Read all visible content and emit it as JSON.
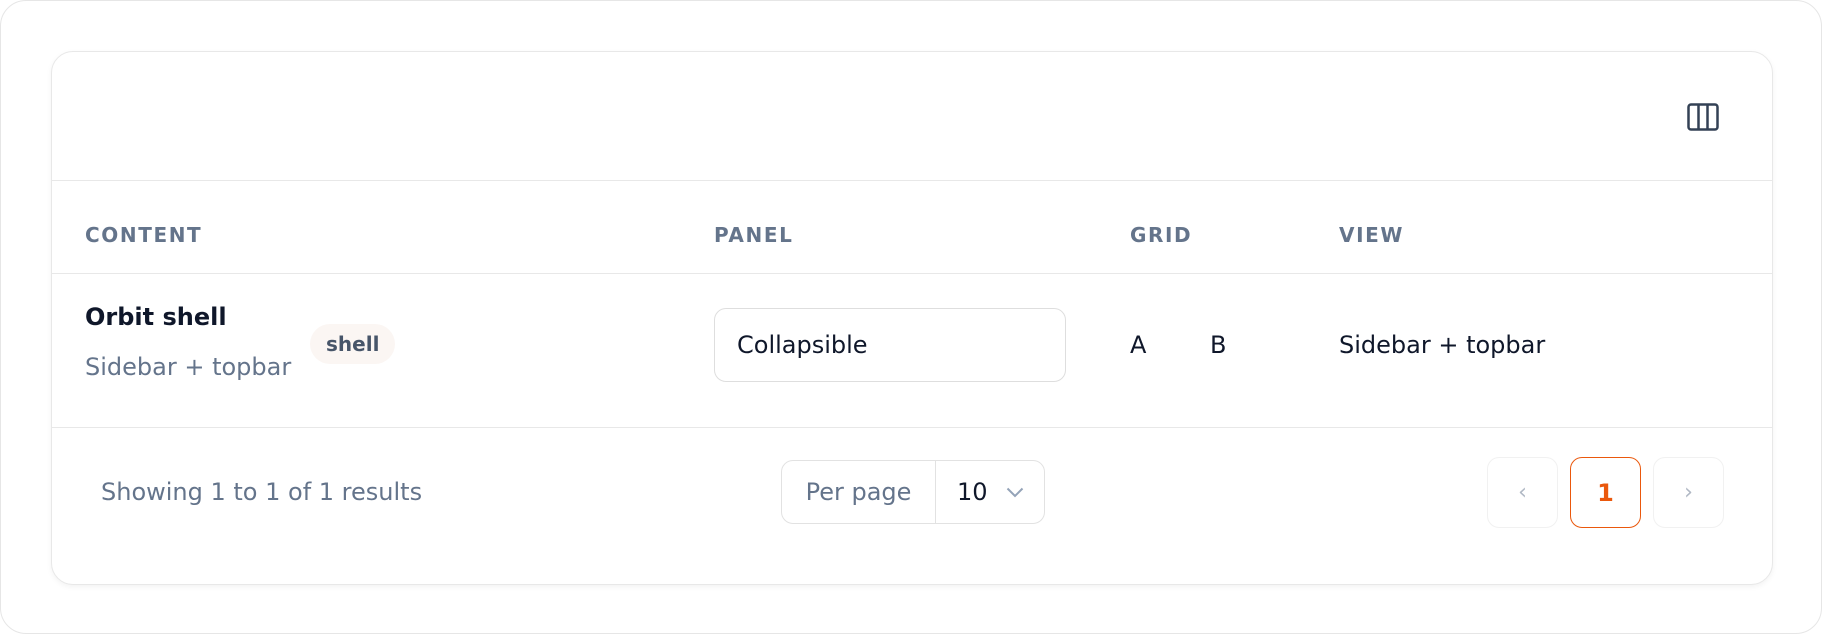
{
  "toolbar": {
    "columns_icon": "columns-icon"
  },
  "table": {
    "headers": [
      "CONTENT",
      "PANEL",
      "GRID",
      "VIEW"
    ],
    "rows": [
      {
        "title": "Orbit shell",
        "subtitle": "Sidebar + topbar",
        "tag": "shell",
        "panel_value": "Collapsible",
        "grid_a": "A",
        "grid_b": "B",
        "view": "Sidebar + topbar"
      }
    ]
  },
  "footer": {
    "showing_text": "Showing 1 to 1 of 1 results",
    "per_page_label": "Per page",
    "per_page_value": "10",
    "prev_label": "‹",
    "current_page": "1",
    "next_label": "›"
  },
  "colors": {
    "accent": "#ea580c",
    "muted_text": "#64748b",
    "text": "#0f172a",
    "border": "#e8e8e8",
    "tag_bg": "#fbf6f3"
  }
}
